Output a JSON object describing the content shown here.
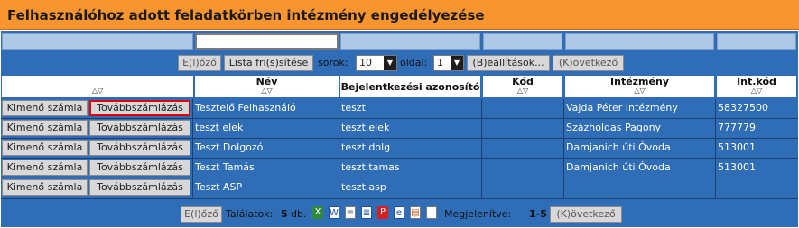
{
  "title": "Felhasználóhoz adott feladatkörben intézmény engedélyezése",
  "colors": {
    "title_bg": "#f8952f",
    "panel_bg": "#2f6db6",
    "highlight_border": "#e00000"
  },
  "pager": {
    "prev_label": "E(l)őző",
    "refresh_label": "Lista fri(s)sítése",
    "rows_label": "sorok:",
    "rows_value": "10",
    "page_label": "oldal:",
    "page_value": "1",
    "settings_label": "(B)eállítások...",
    "next_label": "(K)övetkező"
  },
  "columns": {
    "nev": "Név",
    "login": "Bejelentkezési azonosító",
    "kod": "Kód",
    "intezmeny": "Intézmény",
    "intkod": "Int.kód"
  },
  "row_buttons": {
    "kimeno": "Kimenő számla",
    "tovabb": "Továbbszámlázás"
  },
  "rows": [
    {
      "nev": "Tesztelő Felhasználó",
      "login": "teszt",
      "kod": "",
      "intezmeny": "Vajda Péter Intézmény",
      "intkod": "58327500"
    },
    {
      "nev": "teszt elek",
      "login": "teszt.elek",
      "kod": "",
      "intezmeny": "Százholdas Pagony",
      "intkod": "777779"
    },
    {
      "nev": "Teszt Dolgozó",
      "login": "teszt.dolg",
      "kod": "",
      "intezmeny": "Damjanich úti Óvoda",
      "intkod": "513001"
    },
    {
      "nev": "Teszt Tamás",
      "login": "teszt.tamas",
      "kod": "",
      "intezmeny": "Damjanich úti Óvoda",
      "intkod": "513001"
    },
    {
      "nev": "Teszt ASP",
      "login": "teszt.asp",
      "kod": "",
      "intezmeny": "",
      "intkod": ""
    }
  ],
  "footer": {
    "prev_label": "E(l)őző",
    "results_label": "Találatok:",
    "results_count": "5",
    "results_unit": "db.",
    "shown_label": "Megjelenítve:",
    "shown_range": "1-5",
    "next_label": "(K)övetkező"
  },
  "sort_arrows": "△▽"
}
